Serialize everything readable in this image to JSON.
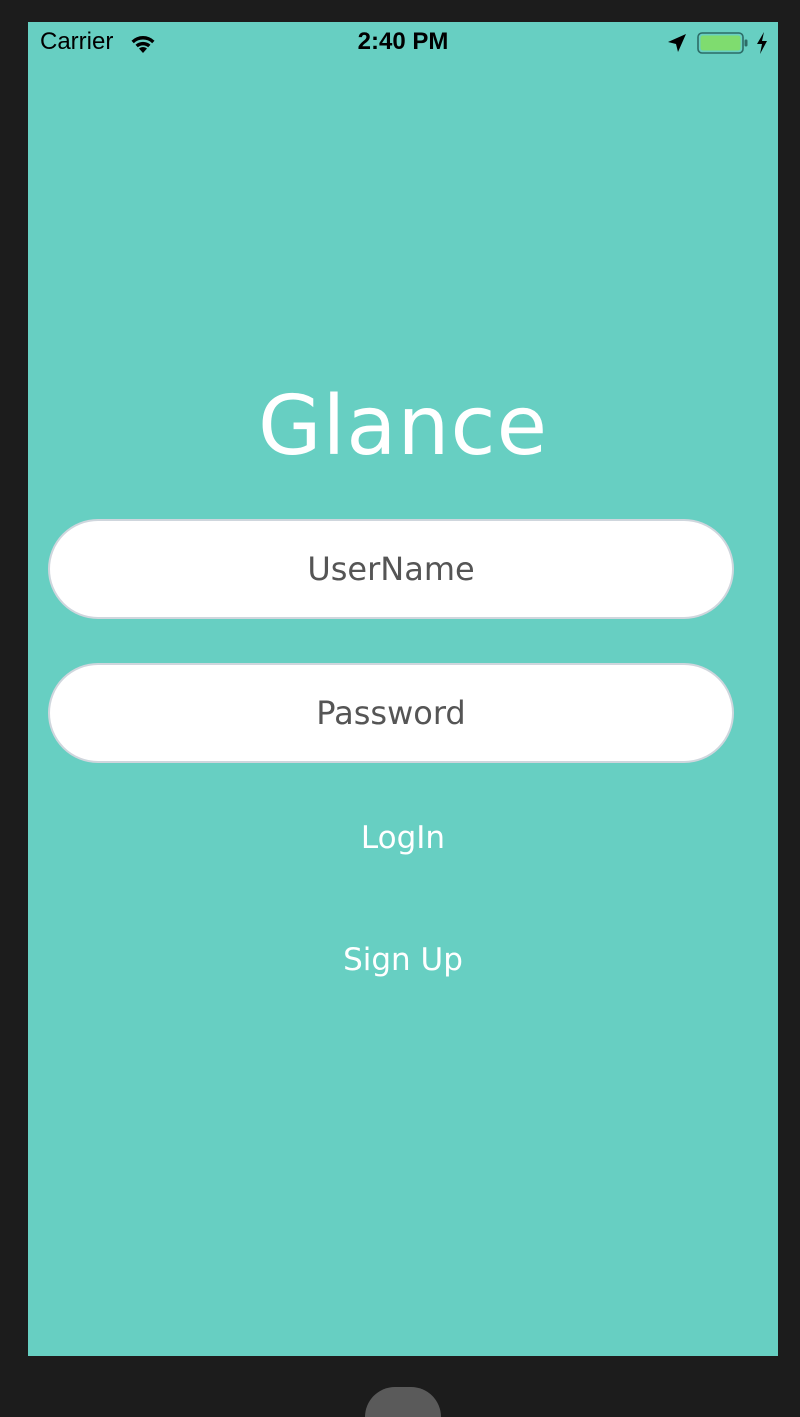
{
  "status_bar": {
    "carrier": "Carrier",
    "time": "2:40 PM",
    "icons": [
      "wifi-icon",
      "location-icon",
      "battery-icon",
      "charging-bolt-icon"
    ]
  },
  "app": {
    "title": "Glance",
    "username": {
      "placeholder": "UserName",
      "value": ""
    },
    "password": {
      "placeholder": "Password",
      "value": ""
    },
    "login_label": "LogIn",
    "signup_label": "Sign Up"
  },
  "colors": {
    "background": "#67cfc2",
    "frame": "#1c1c1c",
    "field_background": "#ffffff",
    "field_border": "#cfd6dd",
    "placeholder_text": "#555555",
    "button_text": "#ffffff",
    "battery_fill": "#7fdc6f"
  },
  "battery_level": 1.0
}
